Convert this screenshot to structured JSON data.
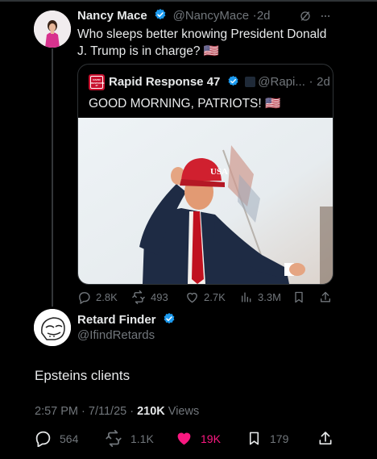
{
  "tweet": {
    "author_name": "Nancy Mace",
    "handle": "@NancyMace",
    "time": "2d",
    "text_line1": "Who sleeps better knowing President Donald",
    "text_line2": "J. Trump is in charge? 🇺🇸",
    "quote": {
      "author_name": "Rapid Response 47",
      "handle": "@Rapi...",
      "time": "2d",
      "text": "GOOD MORNING, PATRIOTS! 🇺🇸",
      "logo_text": "RAPID RESPONSE 47",
      "hat_text": "USA"
    },
    "stats": {
      "replies": "2.8K",
      "retweets": "493",
      "likes": "2.7K",
      "views": "3.3M"
    }
  },
  "reply": {
    "author_name": "Retard Finder",
    "handle": "@IfindRetards",
    "text": "Epsteins clients",
    "time": "2:57 PM",
    "date": "7/11/25",
    "views_count": "210K",
    "views_label": "Views",
    "stats": {
      "replies": "564",
      "retweets": "1.1K",
      "likes": "19K",
      "bookmarks": "179"
    }
  },
  "colors": {
    "text_primary": "#e7e9ea",
    "text_secondary": "#71767b",
    "verified_blue": "#1d9bf0",
    "like_pink": "#f91880",
    "border": "#2f3336"
  },
  "icons": [
    "verified-badge-icon",
    "grok-icon",
    "more-icon",
    "reply-icon",
    "retweet-icon",
    "like-icon",
    "views-icon",
    "bookmark-icon",
    "share-icon"
  ]
}
